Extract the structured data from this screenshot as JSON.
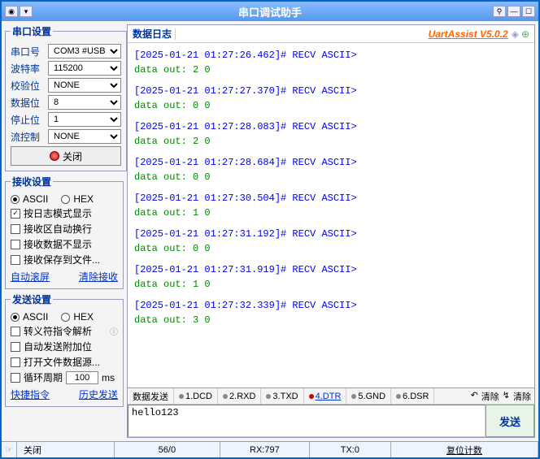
{
  "title": "串口调试助手",
  "brand": "UartAssist V5.0.2",
  "port_settings": {
    "legend": "串口设置",
    "port_label": "串口号",
    "port_value": "COM3 #USB",
    "baud_label": "波特率",
    "baud_value": "115200",
    "parity_label": "校验位",
    "parity_value": "NONE",
    "data_label": "数据位",
    "data_value": "8",
    "stop_label": "停止位",
    "stop_value": "1",
    "flow_label": "流控制",
    "flow_value": "NONE",
    "close_btn": "关闭"
  },
  "recv_settings": {
    "legend": "接收设置",
    "ascii": "ASCII",
    "hex": "HEX",
    "opt1": "按日志模式显示",
    "opt2": "接收区自动换行",
    "opt3": "接收数据不显示",
    "opt4": "接收保存到文件...",
    "link1": "自动滚屏",
    "link2": "清除接收"
  },
  "send_settings": {
    "legend": "发送设置",
    "ascii": "ASCII",
    "hex": "HEX",
    "opt1": "转义符指令解析",
    "opt2": "自动发送附加位",
    "opt3": "打开文件数据源...",
    "opt4": "循环周期",
    "period": "100",
    "unit": "ms",
    "link1": "快捷指令",
    "link2": "历史发送"
  },
  "log": {
    "title": "数据日志",
    "entries": [
      {
        "ts": "[2025-01-21 01:27:26.462]# RECV ASCII>",
        "data": "data out: 2 0"
      },
      {
        "ts": "[2025-01-21 01:27:27.370]# RECV ASCII>",
        "data": "data out: 0 0"
      },
      {
        "ts": "[2025-01-21 01:27:28.083]# RECV ASCII>",
        "data": "data out: 2 0"
      },
      {
        "ts": "[2025-01-21 01:27:28.684]# RECV ASCII>",
        "data": "data out: 0 0"
      },
      {
        "ts": "[2025-01-21 01:27:30.504]# RECV ASCII>",
        "data": "data out: 1 0"
      },
      {
        "ts": "[2025-01-21 01:27:31.192]# RECV ASCII>",
        "data": "data out: 0 0"
      },
      {
        "ts": "[2025-01-21 01:27:31.919]# RECV ASCII>",
        "data": "data out: 1 0"
      },
      {
        "ts": "[2025-01-21 01:27:32.339]# RECV ASCII>",
        "data": "data out: 3 0"
      }
    ]
  },
  "send_area": {
    "tab_label": "数据发送",
    "pins": [
      "1.DCD",
      "2.RXD",
      "3.TXD",
      "4.DTR",
      "5.GND",
      "6.DSR"
    ],
    "clear_btn": "清除",
    "input": "hello123",
    "send_btn": "发送"
  },
  "status": {
    "close": "关闭",
    "counts": "56/0",
    "rx": "RX:797",
    "tx": "TX:0",
    "reset": "复位计数"
  }
}
